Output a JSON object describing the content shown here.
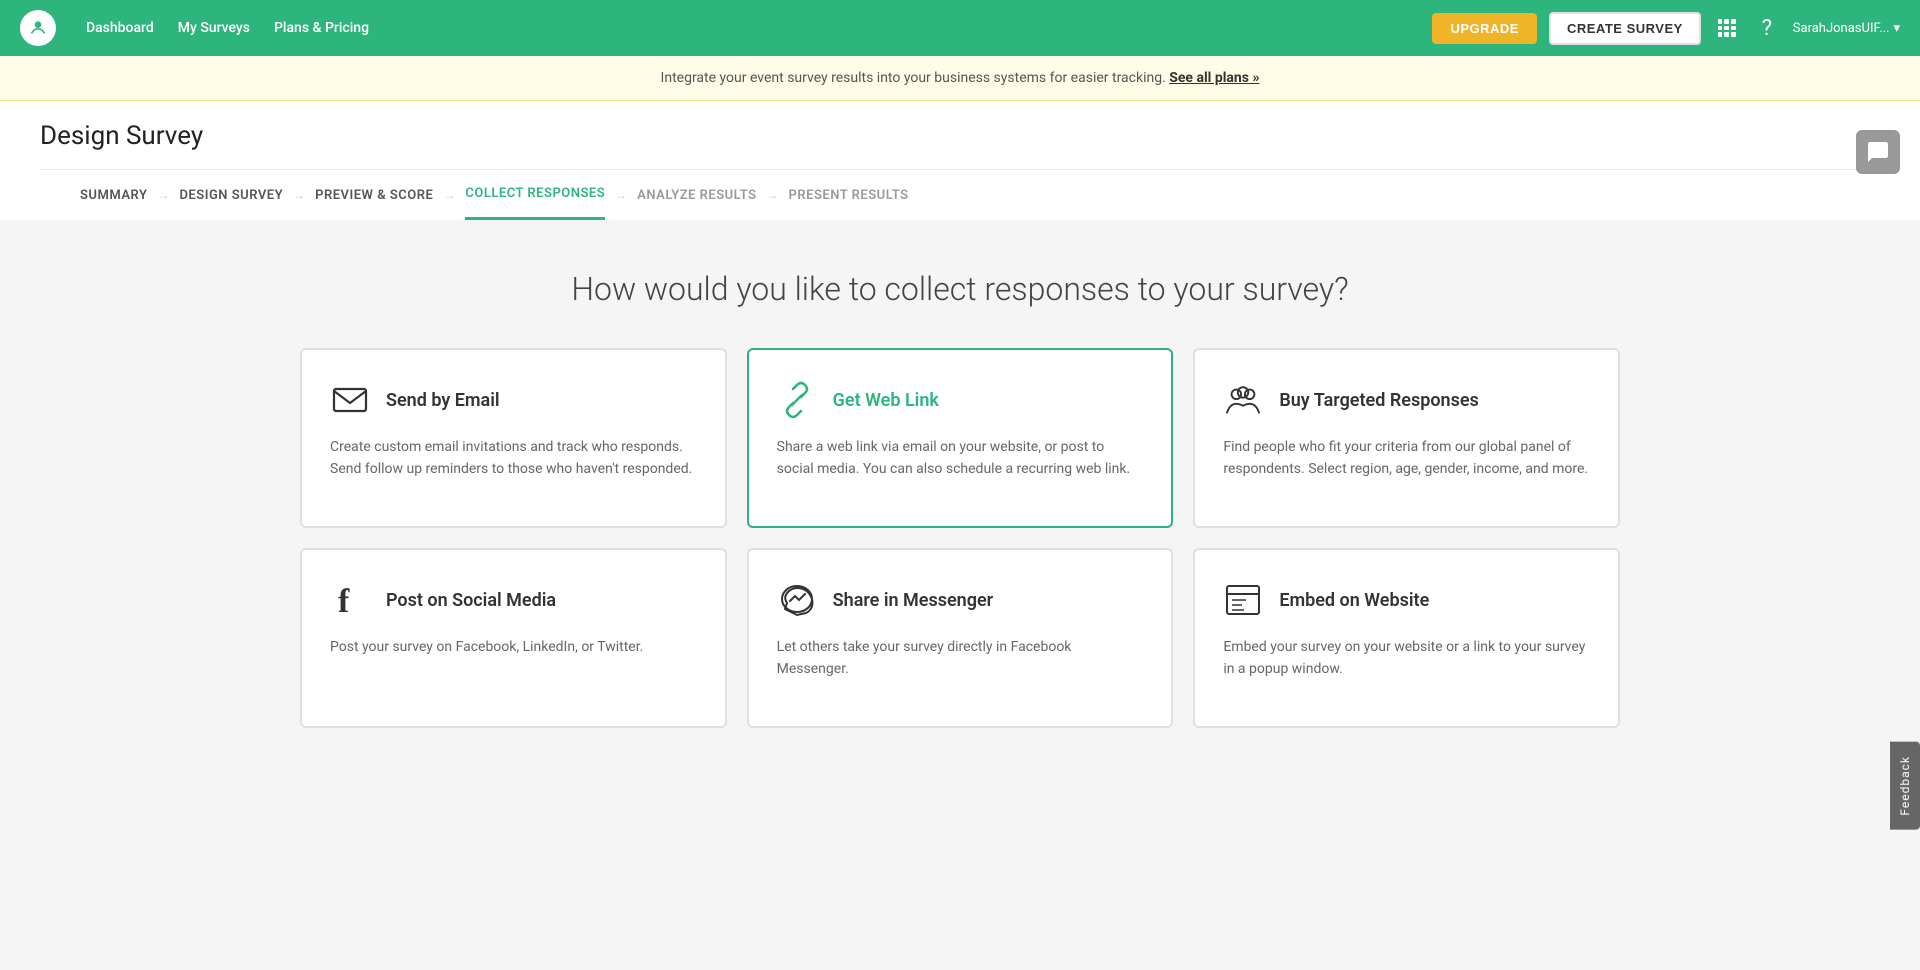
{
  "header": {
    "logo_alt": "SurveyMonkey",
    "nav": [
      {
        "label": "Dashboard",
        "name": "dashboard"
      },
      {
        "label": "My Surveys",
        "name": "my-surveys"
      },
      {
        "label": "Plans & Pricing",
        "name": "plans-pricing"
      }
    ],
    "upgrade_label": "UPGRADE",
    "create_survey_label": "CREATE SURVEY",
    "user": "SarahJonasUIF...",
    "grid_icon": "apps-icon",
    "help_icon": "help-icon"
  },
  "banner": {
    "text": "Integrate your event survey results into your business systems for easier tracking. ",
    "link_text": "See all plans »"
  },
  "page": {
    "title": "Design Survey",
    "steps": [
      {
        "label": "SUMMARY",
        "state": "visited"
      },
      {
        "label": "DESIGN SURVEY",
        "state": "visited"
      },
      {
        "label": "PREVIEW & SCORE",
        "state": "visited"
      },
      {
        "label": "COLLECT RESPONSES",
        "state": "active"
      },
      {
        "label": "ANALYZE RESULTS",
        "state": "default"
      },
      {
        "label": "PRESENT RESULTS",
        "state": "default"
      }
    ]
  },
  "main": {
    "section_title": "How would you like to collect responses to your survey?",
    "cards": [
      {
        "id": "email",
        "icon": "email-icon",
        "title": "Send by Email",
        "description": "Create custom email invitations and track who responds. Send follow up reminders to those who haven't responded.",
        "selected": false
      },
      {
        "id": "weblink",
        "icon": "link-icon",
        "title": "Get Web Link",
        "description": "Share a web link via email on your website, or post to social media. You can also schedule a recurring web link.",
        "selected": true
      },
      {
        "id": "targeted",
        "icon": "audience-icon",
        "title": "Buy Targeted Responses",
        "description": "Find people who fit your criteria from our global panel of respondents. Select region, age, gender, income, and more.",
        "selected": false
      },
      {
        "id": "social",
        "icon": "facebook-icon",
        "title": "Post on Social Media",
        "description": "Post your survey on Facebook, LinkedIn, or Twitter.",
        "selected": false
      },
      {
        "id": "messenger",
        "icon": "messenger-icon",
        "title": "Share in Messenger",
        "description": "Let others take your survey directly in Facebook Messenger.",
        "selected": false
      },
      {
        "id": "embed",
        "icon": "embed-icon",
        "title": "Embed on Website",
        "description": "Embed your survey on your website or a link to your survey in a popup window.",
        "selected": false
      }
    ]
  },
  "feedback": {
    "label": "Feedback"
  }
}
